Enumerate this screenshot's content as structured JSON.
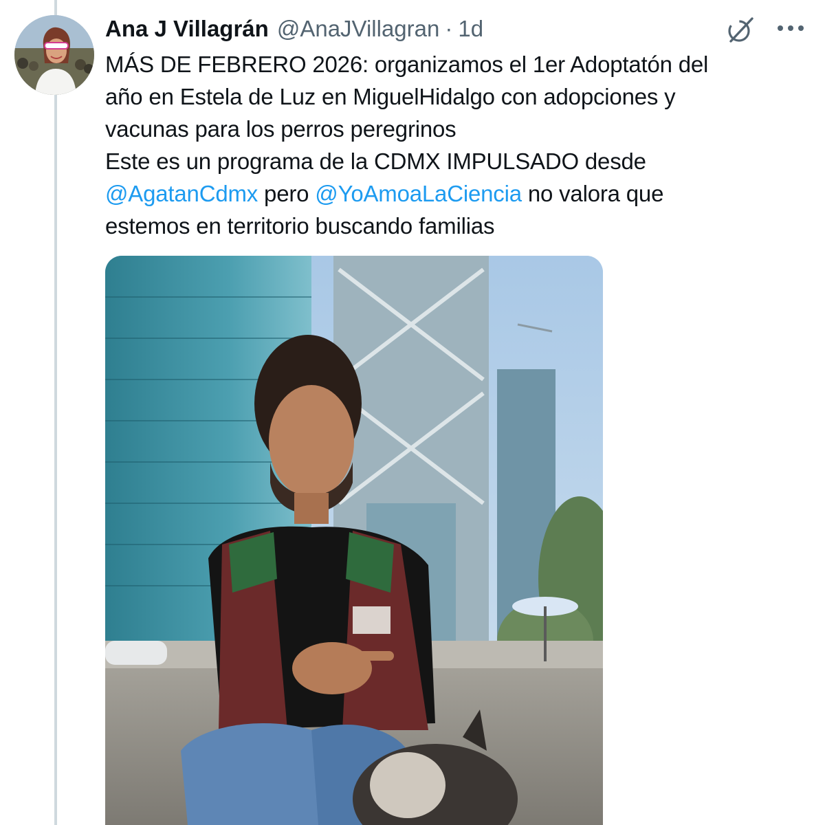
{
  "author": {
    "display_name": "Ana J Villagrán",
    "handle": "@AnaJVillagran",
    "separator": "·",
    "time_ago": "1d"
  },
  "icons": {
    "grok": "grok-icon",
    "more": "more-icon"
  },
  "tweet": {
    "line1": "MÁS DE FEBRERO 2026: organizamos el 1er Adoptatón del",
    "line2": "año en Estela de Luz en MiguelHidalgo con adopciones y",
    "line3": "vacunas para los perros peregrinos",
    "line4": "Este es un programa de la CDMX IMPULSADO desde",
    "mention1": "@AgatanCdmx",
    "connector": "pero",
    "mention2": "@YoAmoaLaCiencia",
    "line5_tail": "no valora que",
    "line6": "estemos en territorio buscando familias"
  },
  "colors": {
    "text": "#0f1419",
    "secondary": "#536471",
    "mention": "#1d9bf0",
    "thread_line": "#cfd9de"
  }
}
